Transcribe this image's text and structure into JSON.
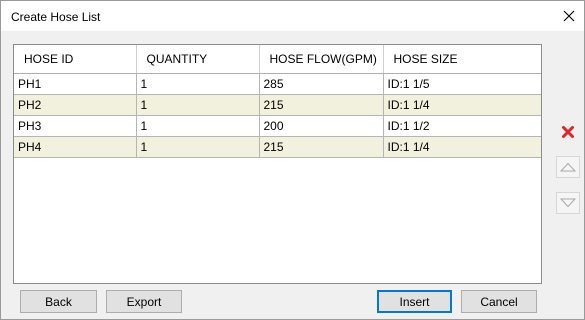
{
  "dialog": {
    "title": "Create Hose List"
  },
  "table": {
    "columns": [
      "HOSE ID",
      "QUANTITY",
      "HOSE FLOW(GPM)",
      "HOSE SIZE"
    ],
    "rows": [
      [
        "PH1",
        "1",
        "285",
        "ID:1 1/5"
      ],
      [
        "PH2",
        "1",
        "215",
        "ID:1 1/4"
      ],
      [
        "PH3",
        "1",
        "200",
        "ID:1 1/2"
      ],
      [
        "PH4",
        "1",
        "215",
        "ID:1 1/4"
      ]
    ]
  },
  "buttons": {
    "back": "Back",
    "export": "Export",
    "insert": "Insert",
    "cancel": "Cancel"
  },
  "icons": {
    "close": "close-icon",
    "delete": "delete-x-icon",
    "move_up": "triangle-up-icon",
    "move_down": "triangle-down-icon"
  },
  "colors": {
    "alt_row": "#f2f1de",
    "delete_red": "#e0242a",
    "focus_blue": "#0078d7"
  }
}
